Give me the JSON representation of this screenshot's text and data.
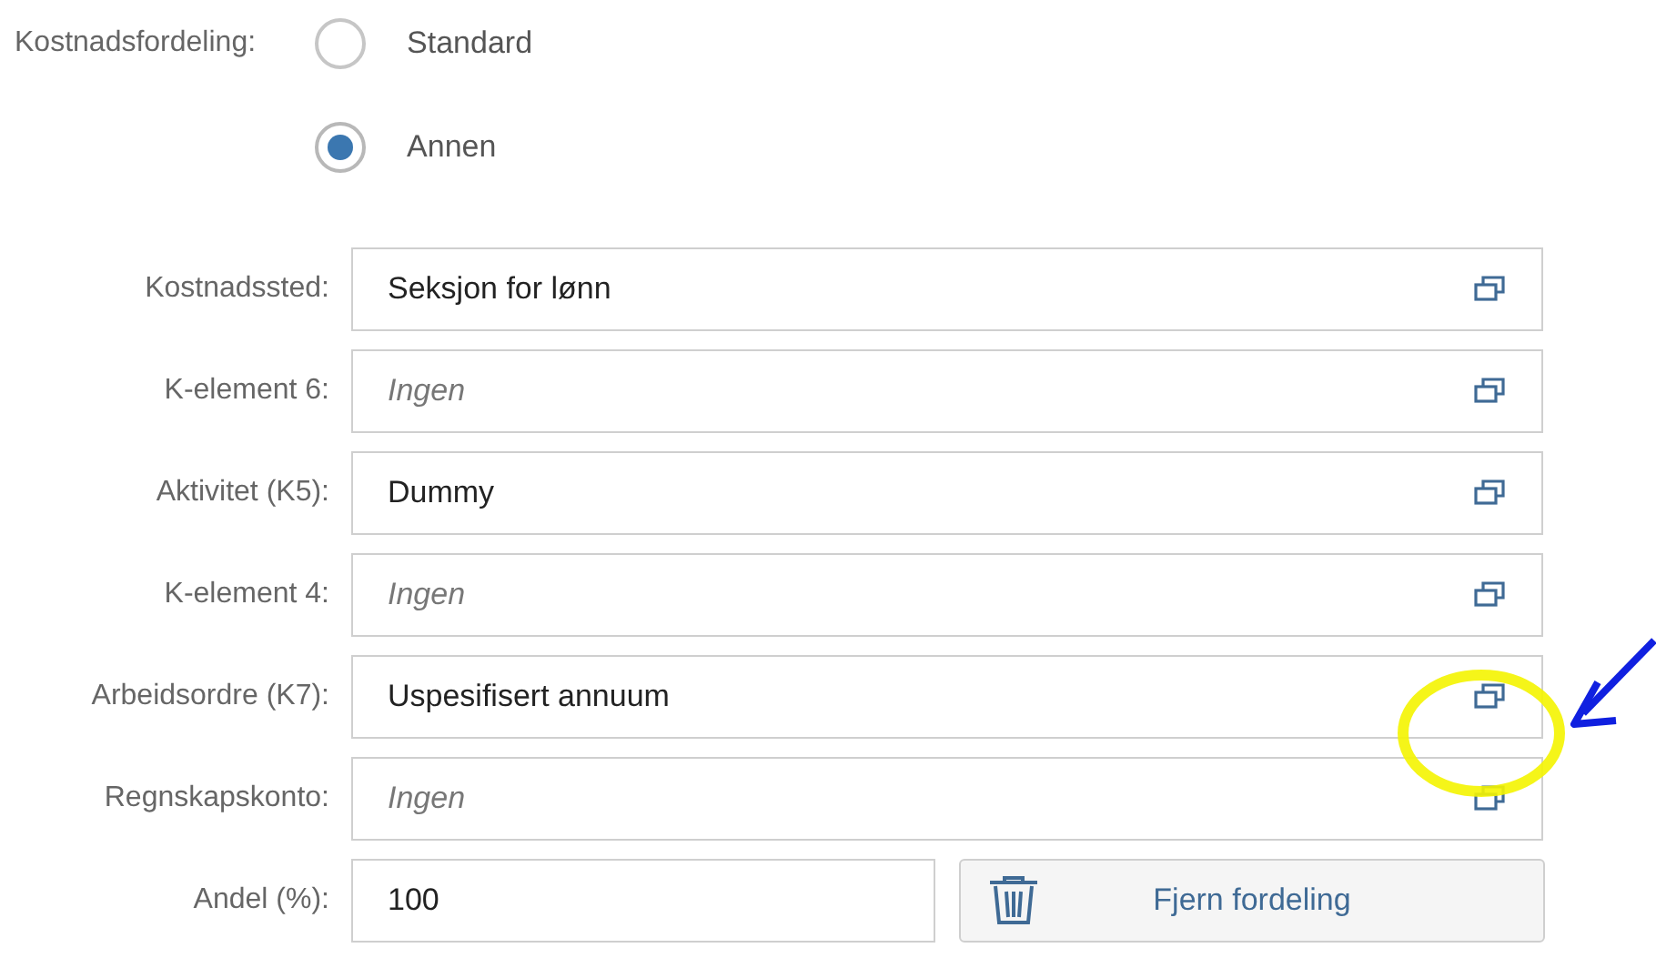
{
  "cost_distribution": {
    "label": "Kostnadsfordeling:",
    "options": [
      {
        "label": "Standard",
        "selected": false
      },
      {
        "label": "Annen",
        "selected": true
      }
    ]
  },
  "fields": [
    {
      "label": "Kostnadssted:",
      "value": "Seksjon for lønn"
    },
    {
      "label": "K-element 6:",
      "placeholder": "Ingen"
    },
    {
      "label": "Aktivitet (K5):",
      "value": "Dummy"
    },
    {
      "label": "K-element 4:",
      "placeholder": "Ingen"
    },
    {
      "label": "Arbeidsordre (K7):",
      "value": "Uspesifisert annuum"
    },
    {
      "label": "Regnskapskonto:",
      "placeholder": "Ingen"
    }
  ],
  "share": {
    "label": "Andel (%):",
    "value": "100"
  },
  "remove_button": {
    "label": "Fjern fordeling"
  }
}
